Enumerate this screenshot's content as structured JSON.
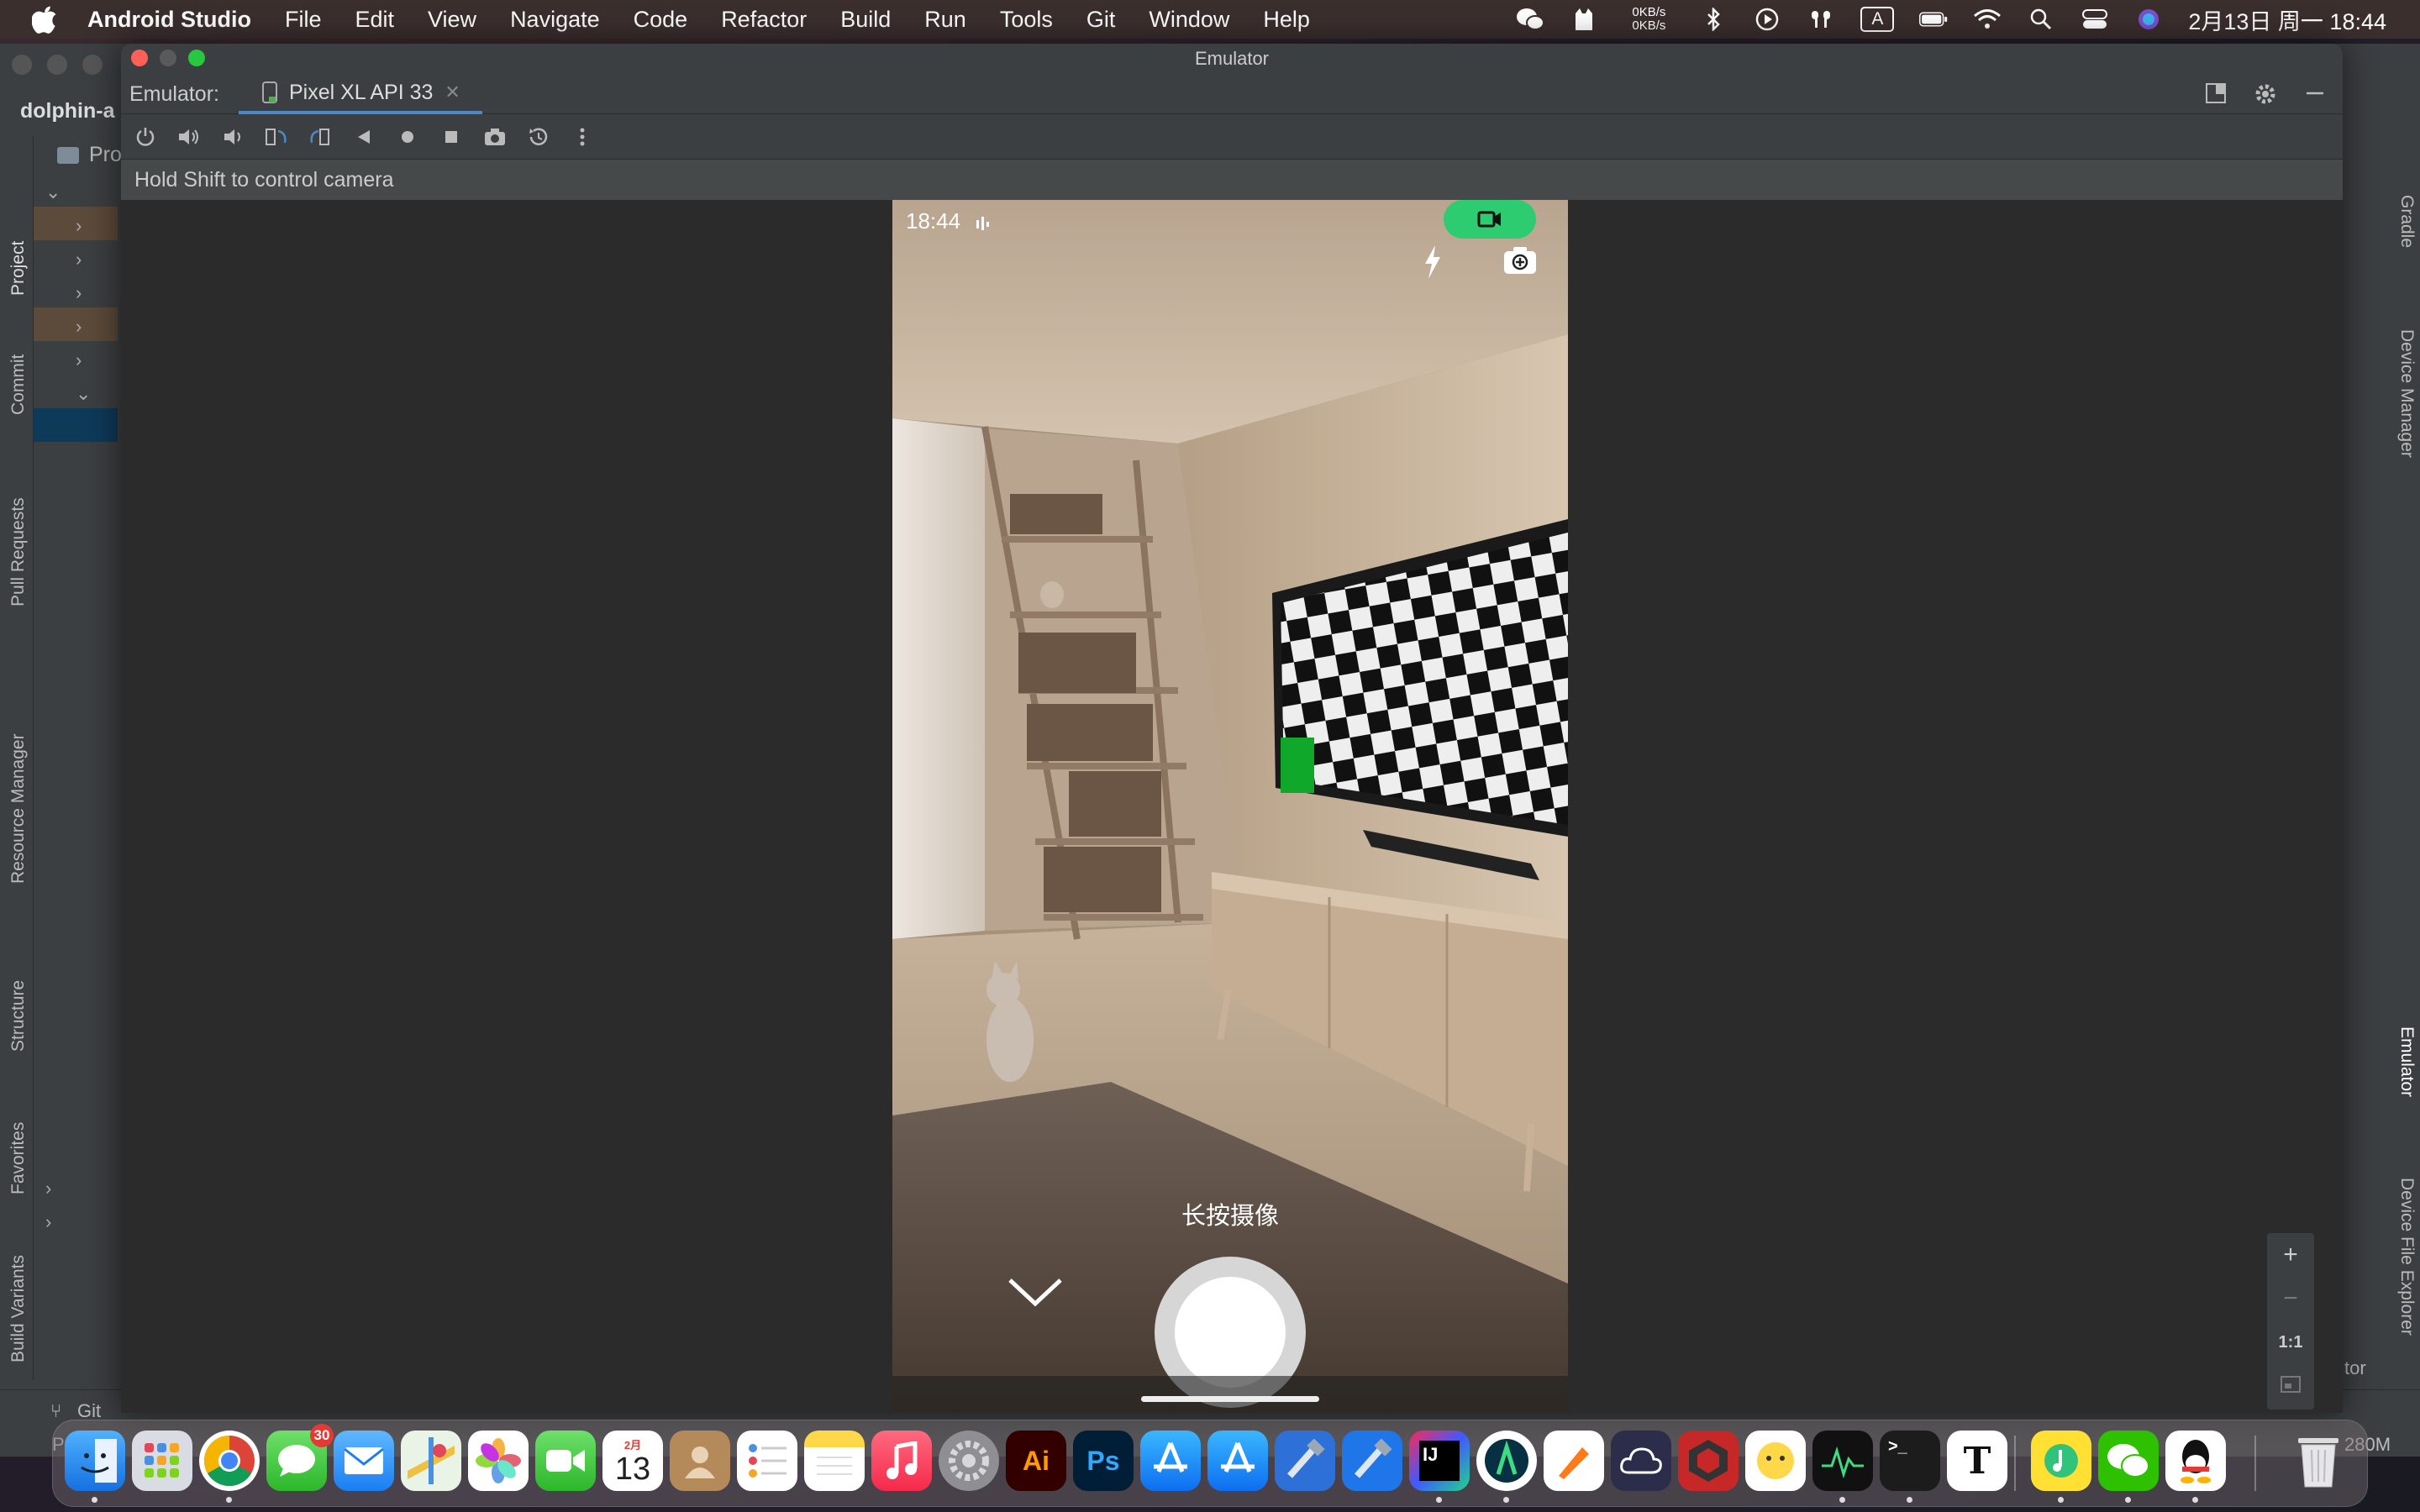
{
  "menubar": {
    "app_name": "Android Studio",
    "items": [
      "File",
      "Edit",
      "View",
      "Navigate",
      "Code",
      "Refactor",
      "Build",
      "Run",
      "Tools",
      "Git",
      "Window",
      "Help"
    ],
    "net_up": "0KB/s",
    "net_down": "0KB/s",
    "input_method": "A",
    "datetime": "2月13日 周一 18:44"
  },
  "ide": {
    "project_name": "dolphin-a",
    "project_tab": "Pro",
    "left_tabs": [
      "Project",
      "Commit",
      "Pull Requests",
      "Resource Manager",
      "Structure",
      "Favorites",
      "Build Variants"
    ],
    "right_tabs": [
      "Gradle",
      "Device Manager",
      "Emulator",
      "Device File Explorer"
    ],
    "bottom_git": "Git",
    "bottom_status": "Pushed",
    "memory": "280M",
    "right_edge_label": "tor"
  },
  "emulator": {
    "window_title": "Emulator",
    "panel_label": "Emulator:",
    "device_tab": "Pixel XL API 33",
    "hint": "Hold Shift to control camera",
    "zoom": {
      "plus": "+",
      "minus": "−",
      "actual": "1:1"
    }
  },
  "phone": {
    "time": "18:44",
    "long_press_label": "长按摄像"
  },
  "dock": {
    "messages_badge": "30",
    "calendar_month": "2月",
    "calendar_day": "13"
  },
  "colors": {
    "accent": "#4a88c7",
    "record_green": "#2ecc71",
    "menubar_bg": "#3b2f2e"
  }
}
